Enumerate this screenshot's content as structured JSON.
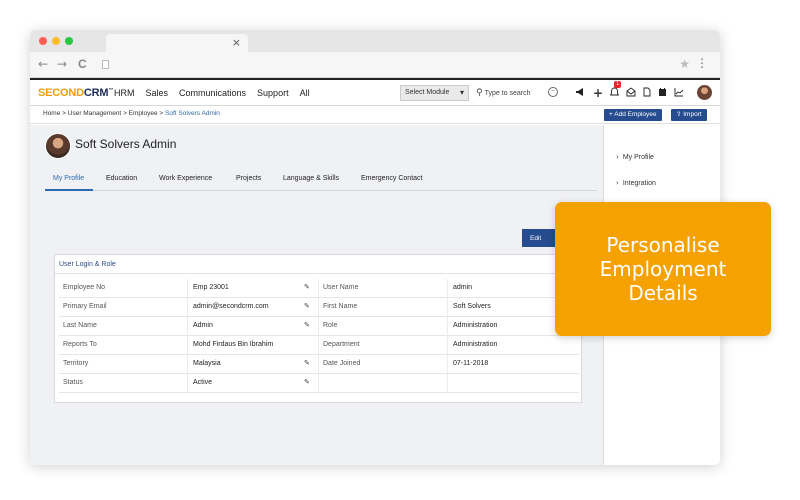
{
  "browser": {
    "tab_close": "×",
    "nav": {
      "back": "←",
      "forward": "→",
      "reload": "C"
    },
    "star": "★",
    "menu": "⋮",
    "dot_colors": [
      "#ff5f57",
      "#febc2e",
      "#28c840"
    ]
  },
  "app": {
    "logo_part1": "SECOND",
    "logo_part2": "CRM",
    "logo_tm": "™",
    "nav": [
      "HRM",
      "Sales",
      "Communications",
      "Support",
      "All"
    ],
    "module_select": "Select Module",
    "module_caret": "▾",
    "search_placeholder": "Type to search",
    "search_icon": "⚲",
    "notification_count": "1",
    "header_icons": [
      "megaphone-icon",
      "plus-icon",
      "bell-icon",
      "mail-icon",
      "document-icon",
      "calendar-icon",
      "chart-icon"
    ]
  },
  "breadcrumb": {
    "items": [
      "Home",
      "User Management",
      "Employee",
      "Soft Solvers Admin"
    ],
    "sep": ">"
  },
  "actions": {
    "add_employee": "+ Add Employee",
    "import": "⇧ Import"
  },
  "profile": {
    "name": "Soft Solvers Admin"
  },
  "tabs": [
    "My Profile",
    "Education",
    "Work Experience",
    "Projects",
    "Language & Skills",
    "Emergency Contact"
  ],
  "edit_label": "Edit",
  "section": {
    "title": "User Login & Role",
    "rows": [
      {
        "l1": "Employee No",
        "v1": "Emp 23001",
        "e1": true,
        "l2": "User Name",
        "v2": "admin"
      },
      {
        "l1": "Primary Email",
        "v1": "admin@secondcrm.com",
        "e1": true,
        "l2": "First Name",
        "v2": "Soft Solvers"
      },
      {
        "l1": "Last Name",
        "v1": "Admin",
        "e1": true,
        "l2": "Role",
        "v2": "Administration"
      },
      {
        "l1": "Reports To",
        "v1": "Mohd Firdaus Bin Ibrahim",
        "e1": false,
        "l2": "Department",
        "v2": "Administration"
      },
      {
        "l1": "Territory",
        "v1": "Malaysia",
        "e1": true,
        "l2": "Date Joined",
        "v2": "07-11-2018"
      },
      {
        "l1": "Status",
        "v1": "Active",
        "e1": true,
        "l2": "",
        "v2": ""
      }
    ]
  },
  "sidebar": {
    "items": [
      "My Profile",
      "Integration"
    ],
    "chevron": "›"
  },
  "callout": {
    "line1": "Personalise",
    "line2": "Employment",
    "line3": "Details"
  },
  "colors": {
    "accent": "#264b8f",
    "link": "#2d6ab0",
    "callout": "#f5a100",
    "logo_orange": "#f0a000"
  },
  "pencil": "✎"
}
